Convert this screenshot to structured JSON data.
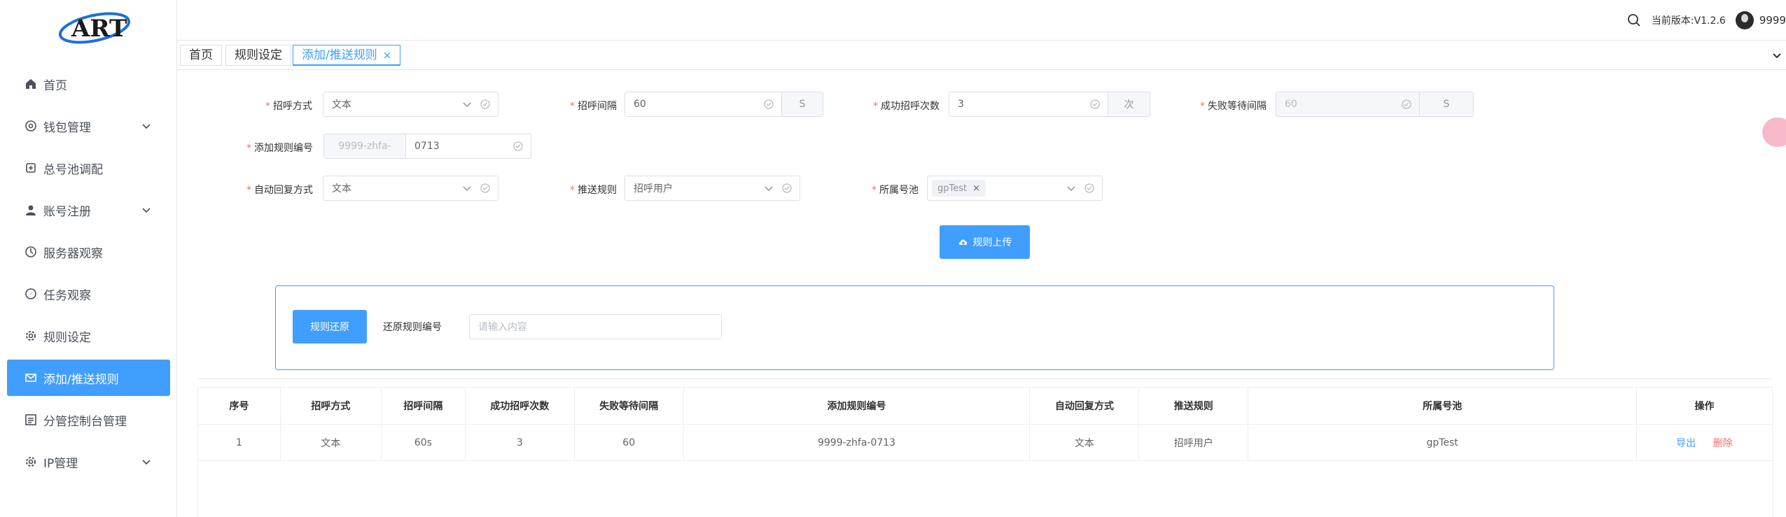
{
  "app": {
    "logo_text": "ART",
    "accent": "#409eff",
    "danger": "#f56c6c"
  },
  "header": {
    "version": "当前版本:V1.2.6",
    "username": "9999"
  },
  "sidebar": {
    "items": [
      {
        "label": "首页",
        "icon": "home-icon"
      },
      {
        "label": "钱包管理",
        "icon": "wallet-icon"
      },
      {
        "label": "总号池调配",
        "icon": "pool-icon"
      },
      {
        "label": "账号注册",
        "icon": "user-icon"
      },
      {
        "label": "服务器观察",
        "icon": "server-icon"
      },
      {
        "label": "任务观察",
        "icon": "compass-icon"
      },
      {
        "label": "规则设定",
        "icon": "gear-icon"
      },
      {
        "label": "添加/推送规则",
        "icon": "mail-icon"
      },
      {
        "label": "分管控制台管理",
        "icon": "console-icon"
      },
      {
        "label": "IP管理",
        "icon": "ip-icon"
      }
    ]
  },
  "tabs": [
    {
      "label": "首页"
    },
    {
      "label": "规则设定"
    },
    {
      "label": "添加/推送规则",
      "close": "×"
    }
  ],
  "form": {
    "greeting_mode": {
      "label": "招呼方式",
      "value": "文本"
    },
    "greeting_interval": {
      "label": "招呼间隔",
      "value": "60",
      "unit": "S"
    },
    "success_count": {
      "label": "成功招呼次数",
      "value": "3",
      "unit": "次"
    },
    "fail_wait": {
      "label": "失败等待间隔",
      "value": "60",
      "unit": "S"
    },
    "rule_no": {
      "label": "添加规则编号",
      "prefix": "9999-zhfa-",
      "value": "0713"
    },
    "auto_reply": {
      "label": "自动回复方式",
      "value": "文本"
    },
    "push_rule": {
      "label": "推送规则",
      "value": "招呼用户"
    },
    "pool": {
      "label": "所属号池",
      "tag": "gpTest",
      "tag_close": "×"
    },
    "upload_button": "规则上传",
    "required_mark": "*"
  },
  "restore": {
    "button": "规则还原",
    "label": "还原规则编号",
    "placeholder": "请输入内容"
  },
  "table": {
    "headers": [
      "序号",
      "招呼方式",
      "招呼间隔",
      "成功招呼次数",
      "失败等待间隔",
      "添加规则编号",
      "自动回复方式",
      "推送规则",
      "所属号池",
      "操作"
    ],
    "rows": [
      {
        "cells": [
          "1",
          "文本",
          "60s",
          "3",
          "60",
          "9999-zhfa-0713",
          "文本",
          "招呼用户",
          "gpTest"
        ],
        "actions": [
          "导出",
          "删除"
        ]
      }
    ]
  }
}
